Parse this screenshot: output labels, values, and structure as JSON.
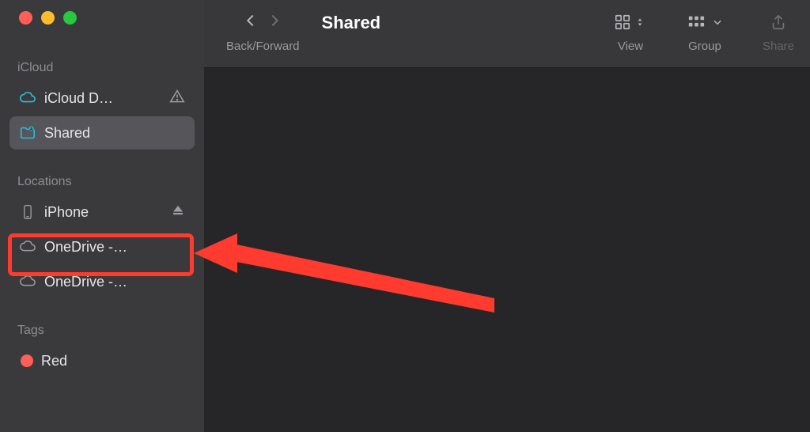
{
  "title": "Shared",
  "toolbar": {
    "back_forward_label": "Back/Forward",
    "view_label": "View",
    "group_label": "Group",
    "share_label": "Share"
  },
  "sidebar": {
    "sections": [
      {
        "label": "iCloud",
        "items": [
          {
            "label": "iCloud D…",
            "icon": "cloud",
            "icon_color": "#2fb8d8",
            "warning": true
          },
          {
            "label": "Shared",
            "icon": "shared-folder",
            "icon_color": "#2fb8d8",
            "selected": true
          }
        ]
      },
      {
        "label": "Locations",
        "items": [
          {
            "label": "iPhone",
            "icon": "phone",
            "icon_color": "#9d9da2",
            "eject": true,
            "highlighted": true
          },
          {
            "label": "OneDrive -…",
            "icon": "cloud-outline",
            "icon_color": "#9d9da2"
          },
          {
            "label": "OneDrive -…",
            "icon": "cloud-outline",
            "icon_color": "#9d9da2"
          }
        ]
      },
      {
        "label": "Tags",
        "items": [
          {
            "label": "Red",
            "icon": "tag-dot",
            "icon_color": "#ff5f56"
          }
        ]
      }
    ]
  },
  "annotation": {
    "highlight_color": "#ff3b2f"
  }
}
